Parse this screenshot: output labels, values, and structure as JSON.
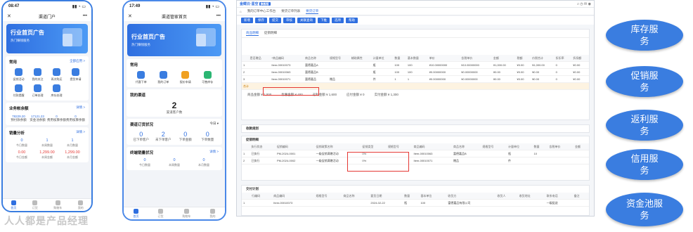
{
  "phone1": {
    "time": "08:47",
    "title": "渠道门户",
    "banner": {
      "title": "行业首页广告",
      "subtitle": "热门赚钱服务"
    },
    "common": {
      "title": "常用",
      "more": "全部应用 >"
    },
    "apps": [
      "促销活动",
      "我的关注",
      "再次购买",
      "提货申请",
      "付款提醒",
      "订单处理",
      "库存处理"
    ],
    "balance": {
      "title": "业务帐余额",
      "more": "详情 >",
      "items": [
        {
          "value": "78229.20",
          "label": "预付款余额"
        },
        {
          "value": "17121.23",
          "label": "资金池余额"
        },
        {
          "value": "0",
          "label": "费用核算余额"
        },
        {
          "value": "0",
          "label": "费用核算余额"
        }
      ]
    },
    "sales": {
      "title": "销量分析",
      "more": "详情 >",
      "row1": [
        {
          "value": "0",
          "label": "今日数量"
        },
        {
          "value": "1",
          "label": "本周数量"
        },
        {
          "value": "1",
          "label": "本月数量"
        }
      ],
      "row2": [
        {
          "value": "0.00",
          "label": "今日金额"
        },
        {
          "value": "1,299.00",
          "label": "本周金额"
        },
        {
          "value": "1,299.00",
          "label": "本月金额"
        }
      ]
    },
    "tabs": [
      "首页",
      "订货",
      "购物车",
      "我的",
      "我的"
    ]
  },
  "phone2": {
    "time": "17:49",
    "title": "渠道管家首页",
    "banner": {
      "title": "行业首页广告",
      "subtitle": "热门赚钱服务"
    },
    "common": {
      "title": "常用"
    },
    "apps": [
      "代客下单",
      "我的订单",
      "报价申请",
      "可售库存"
    ],
    "channel": {
      "title": "我的渠道",
      "value": "2",
      "label": "渠道客户数"
    },
    "orders": {
      "title": "渠道订货状况",
      "period": "今日 ▾",
      "items": [
        {
          "value": "0",
          "label": "已下单客户"
        },
        {
          "value": "2",
          "label": "未下单客户"
        },
        {
          "value": "0",
          "label": "下单金额"
        },
        {
          "value": "0",
          "label": "下单数量"
        }
      ]
    },
    "terminal": {
      "title": "终端销量状况",
      "more": "详情 >",
      "items": [
        {
          "value": "0",
          "label": "今日数量"
        },
        {
          "value": "0",
          "label": "本周数量"
        },
        {
          "value": "0",
          "label": "本月数量"
        }
      ]
    },
    "tabs": [
      "首页",
      "订货",
      "购物车",
      "我的"
    ]
  },
  "desktop": {
    "logo": "金蝶云·星空",
    "logo_tag": "旗舰版",
    "tabs": [
      "我的订单中心工作台",
      "要货订单列表",
      "要货订单"
    ],
    "toolbar": [
      "新增",
      "保存",
      "提交",
      "审核",
      "关联查询",
      "下推",
      "选项",
      "帮助"
    ],
    "panel_tabs": [
      "商品明细",
      "促销明细"
    ],
    "goods_headers": [
      "",
      "是否赠品",
      "*商品编码",
      "商品名称",
      "规格型号",
      "辅助属性",
      "计量单位",
      "数量",
      "基本数量",
      "单价",
      "含税单价",
      "金额",
      "税额",
      "价税合计",
      "折扣率",
      "折扣额"
    ],
    "goods_rows": [
      [
        "1",
        "",
        "Item-00010073",
        "富德嘉品A",
        "",
        "",
        "瓶",
        "100",
        "100",
        "¥10.00000000",
        "¥10.00000000",
        "¥1,000.00",
        "¥0.00",
        "¥1,000.00",
        "0",
        "¥0.00"
      ],
      [
        "2",
        "",
        "Item-00010063",
        "富德嘉品B",
        "",
        "",
        "瓶",
        "100",
        "100",
        "¥0.00000000",
        "¥0.00000000",
        "¥0.00",
        "¥0.00",
        "¥0.00",
        "0",
        "¥0.00"
      ],
      [
        "3",
        "",
        "Item-00010071",
        "富德嘉品",
        "赠品",
        "",
        "件",
        "1",
        "1",
        "¥0.00000000",
        "¥0.00000000",
        "¥0.00",
        "¥0.00",
        "¥0.00",
        "0",
        "¥0.00"
      ]
    ],
    "goods_total": "合计",
    "summary": [
      "商品金额 ¥ 2,000",
      "优惠金额 ¥ 400",
      "返利金额 ¥ 1,600",
      "应付金额 ¥ 0",
      "实付金额 ¥ 1,300"
    ],
    "sections": [
      "收款规划",
      "促销明细",
      "交付计划"
    ],
    "promo_headers": [
      "",
      "执行状态",
      "促销编码",
      "促销政策名称",
      "促销类型",
      "规格型号",
      "商品编码",
      "商品名称",
      "规格型号",
      "计量单位",
      "数量",
      "含税单价",
      "金额"
    ],
    "promo_rows": [
      [
        "1",
        "已执行",
        "PM-2024-0001",
        "一级促销满赠活动",
        "0%",
        "",
        "Item-00010063",
        "富德嘉品B",
        "",
        "瓶",
        "10",
        "",
        ""
      ],
      [
        "2",
        "已执行",
        "PM-2024-0002",
        "一级促销满赠活动",
        "0%",
        "",
        "Item-00010071",
        "赠品",
        "",
        "件",
        "",
        "",
        ""
      ]
    ],
    "delivery_headers": [
      "",
      "行编码",
      "商品编码",
      "规格型号",
      "商品名称",
      "要货日期",
      "数量",
      "基本单位",
      "收货方",
      "收货人",
      "收货地址",
      "联系电话",
      "备注"
    ],
    "delivery_rows": [
      [
        "1",
        "",
        "Item-00010073",
        "",
        "",
        "2024-02-22",
        "瓶",
        "100",
        "富德嘉品有限公司",
        "",
        "",
        "一级配送",
        ""
      ]
    ]
  },
  "pills": [
    "库存服务",
    "促销服务",
    "返利服务",
    "信用服务",
    "资金池服务"
  ],
  "watermark": "人人都是产品经理"
}
